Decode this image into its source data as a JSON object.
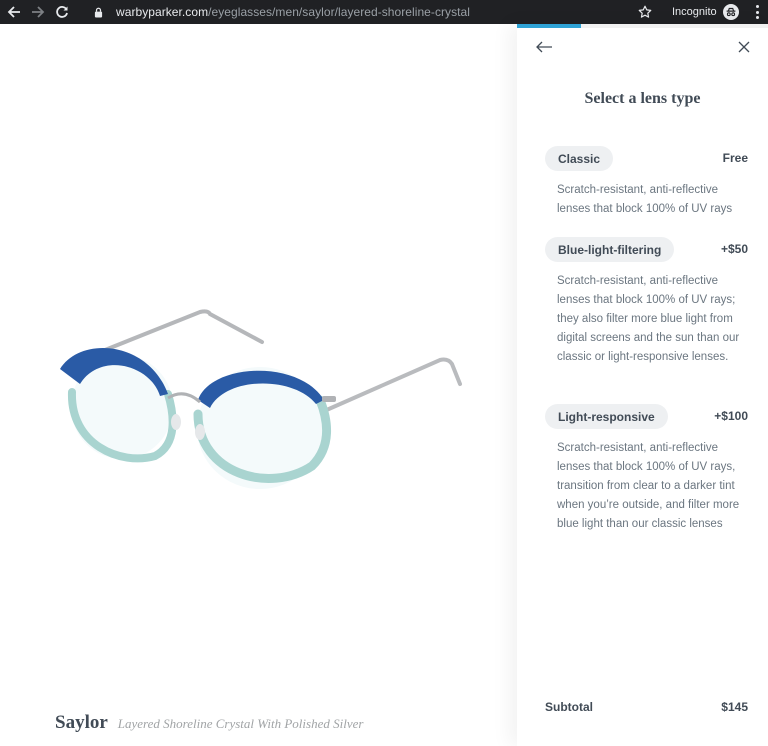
{
  "browser": {
    "url_host": "warbyparker.com",
    "url_path": "/eyeglasses/men/saylor/layered-shoreline-crystal",
    "incognito_label": "Incognito",
    "icons": [
      "back-arrow-icon",
      "forward-arrow-icon",
      "reload-icon",
      "lock-icon",
      "star-icon",
      "incognito-icon",
      "kebab-menu-icon"
    ]
  },
  "product": {
    "name": "Saylor",
    "variant": "Layered Shoreline Crystal With Polished Silver",
    "image_icon": "eyeglasses"
  },
  "panel": {
    "title": "Select a lens type",
    "progress_fraction": 0.255,
    "accent_color": "#2fa3d6",
    "lens_options": [
      {
        "label": "Classic",
        "price": "Free",
        "description": "Scratch-resistant, anti-reflective lenses that block 100% of UV rays"
      },
      {
        "label": "Blue-light-filtering",
        "price": "+$50",
        "description": "Scratch-resistant, anti-reflective lenses that block 100% of UV rays; they also filter more blue light from digital screens and the sun than our classic or light-responsive lenses."
      },
      {
        "label": "Light-responsive",
        "price": "+$100",
        "description": "Scratch-resistant, anti-reflective lenses that block 100% of UV rays, transition from clear to a darker tint when you’re outside, and filter more blue light than our classic lenses"
      }
    ],
    "subtotal_label": "Subtotal",
    "subtotal_value": "$145"
  },
  "colors": {
    "chrome_bg": "#202124",
    "text_primary": "#414b56",
    "text_secondary": "#6b7680",
    "pill_bg": "#eef0f2",
    "frame_blue": "#2a5ba6",
    "lens_aqua": "#a9d4d0"
  }
}
